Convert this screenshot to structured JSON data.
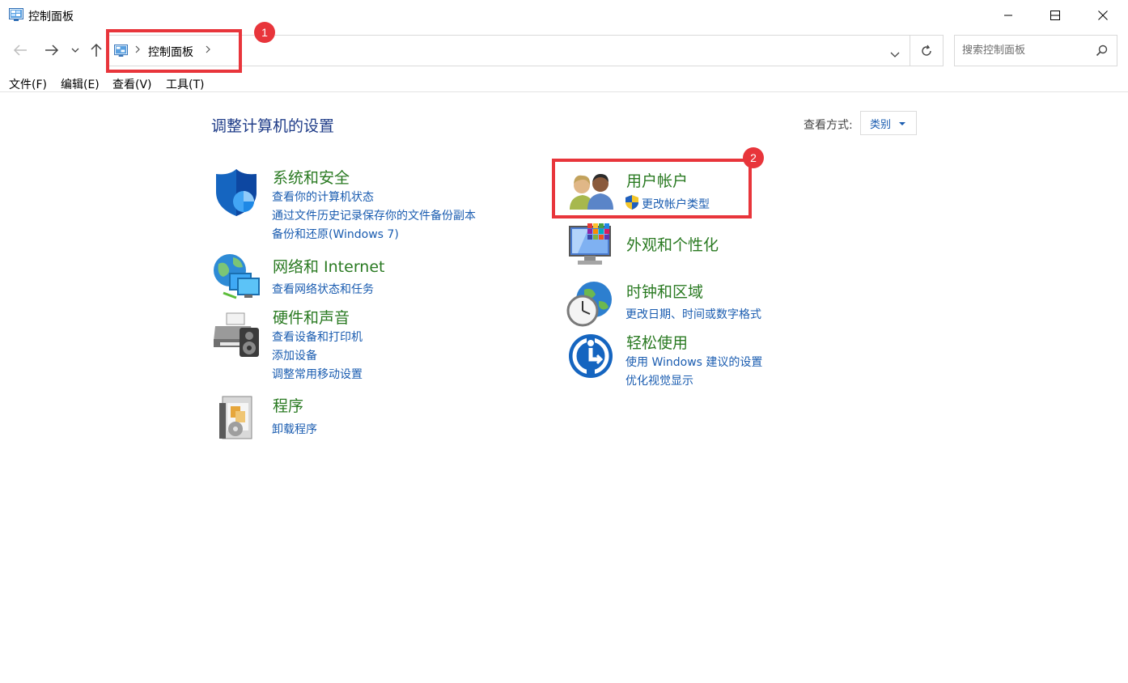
{
  "window": {
    "title": "控制面板"
  },
  "address": {
    "crumb": "控制面板"
  },
  "search": {
    "placeholder": "搜索控制面板"
  },
  "menu": [
    "文件(F)",
    "编辑(E)",
    "查看(V)",
    "工具(T)"
  ],
  "header": {
    "title": "调整计算机的设置",
    "viewby_label": "查看方式:",
    "viewby_value": "类别"
  },
  "annotations": {
    "badge1": "1",
    "badge2": "2"
  },
  "categories": {
    "system": {
      "title": "系统和安全",
      "links": [
        "查看你的计算机状态",
        "通过文件历史记录保存你的文件备份副本",
        "备份和还原(Windows 7)"
      ]
    },
    "network": {
      "title": "网络和 Internet",
      "links": [
        "查看网络状态和任务"
      ]
    },
    "hardware": {
      "title": "硬件和声音",
      "links": [
        "查看设备和打印机",
        "添加设备",
        "调整常用移动设置"
      ]
    },
    "programs": {
      "title": "程序",
      "links": [
        "卸载程序"
      ]
    },
    "users": {
      "title": "用户帐户",
      "links": [
        "更改帐户类型"
      ]
    },
    "appearance": {
      "title": "外观和个性化",
      "links": []
    },
    "clock": {
      "title": "时钟和区域",
      "links": [
        "更改日期、时间或数字格式"
      ]
    },
    "ease": {
      "title": "轻松使用",
      "links": [
        "使用 Windows 建议的设置",
        "优化视觉显示"
      ]
    }
  },
  "colors": {
    "accent_link": "#1a5cb0",
    "category_title": "#2a7a22",
    "annotation_red": "#e8353b"
  }
}
